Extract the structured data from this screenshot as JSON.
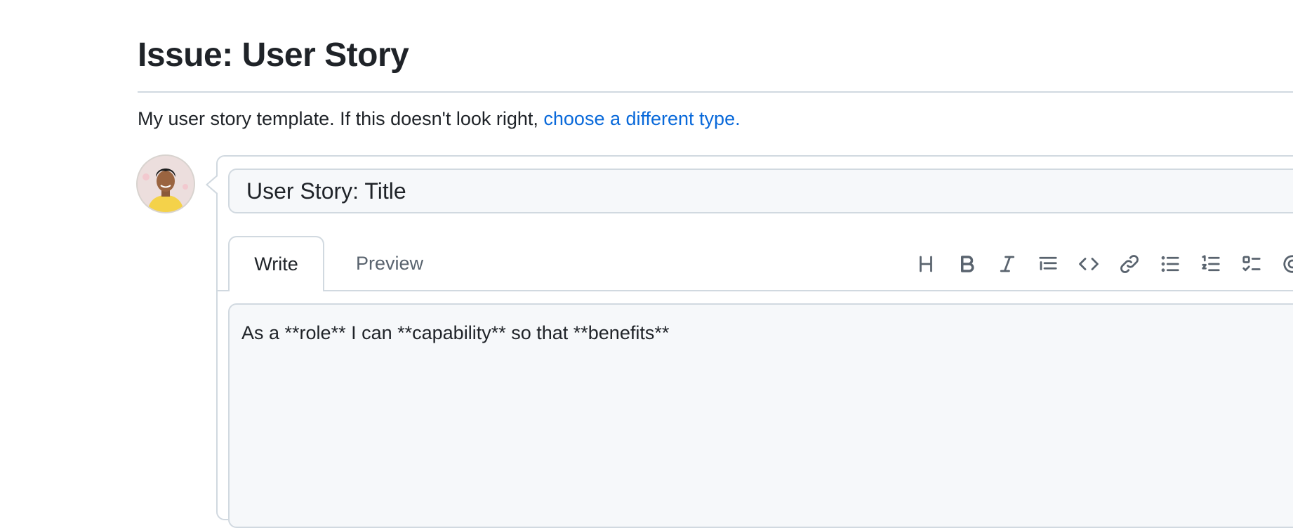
{
  "page": {
    "title": "Issue: User Story",
    "subtitle_text": "My user story template. If this doesn't look right, ",
    "subtitle_link": "choose a different type."
  },
  "form": {
    "title_value": "User Story: Title",
    "body_value": "As a **role** I can **capability** so that **benefits**"
  },
  "tabs": [
    {
      "label": "Write",
      "active": true
    },
    {
      "label": "Preview",
      "active": false
    }
  ],
  "toolbar": {
    "icons": [
      "heading-icon",
      "bold-icon",
      "italic-icon",
      "quote-icon",
      "code-icon",
      "link-icon",
      "bulleted-list-icon",
      "numbered-list-icon",
      "task-list-icon",
      "mention-icon"
    ]
  },
  "colors": {
    "link": "#0969da",
    "border": "#d1d9e0",
    "input_bg": "#f6f8fa",
    "icon": "#59636e"
  }
}
